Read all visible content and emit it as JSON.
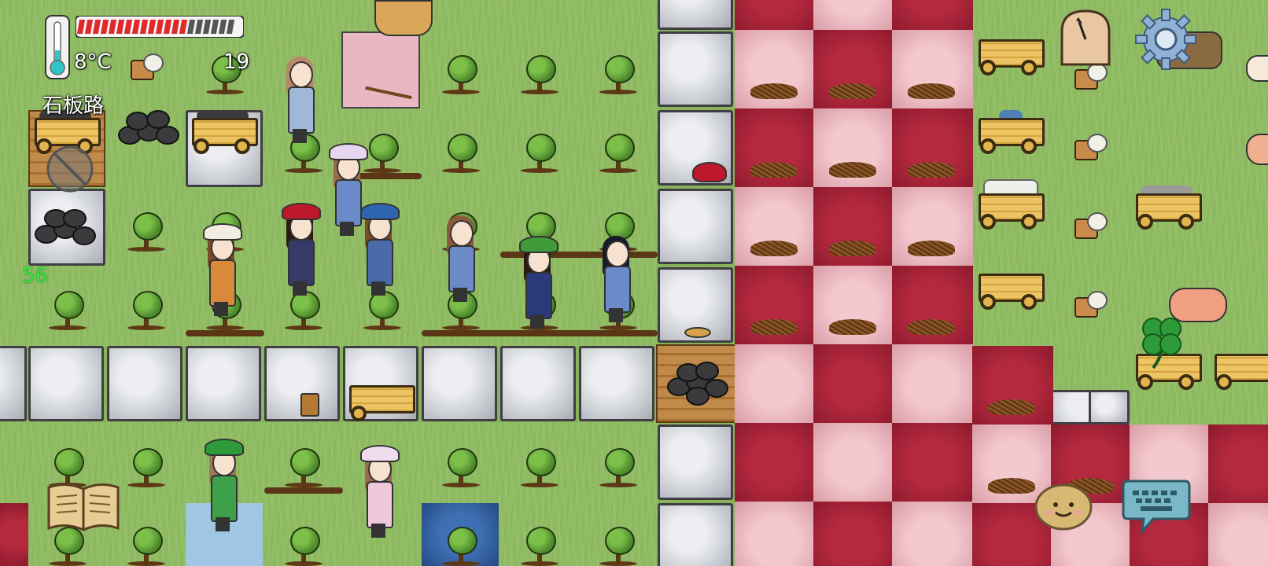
{
  "hud": {
    "temperature": "8°C",
    "counter": "19",
    "location": "石板路",
    "food_value": "56",
    "health_segments_filled": 0.72
  },
  "icons": {
    "thermometer": "thermometer-icon",
    "settings": "gear-icon",
    "clock": "clock-icon",
    "journal": "book-icon",
    "emote": "potato-face-icon",
    "chat": "keyboard-chat-icon",
    "luck": "four-leaf-clover-icon"
  },
  "colors": {
    "health_bar": "#e02a2a",
    "food_text": "#39e63a",
    "hud_text": "#ffffff"
  }
}
